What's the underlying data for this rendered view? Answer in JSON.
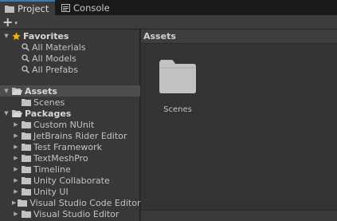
{
  "tabs": [
    {
      "label": "Project",
      "icon": "folder-icon",
      "active": true
    },
    {
      "label": "Console",
      "icon": "console-icon",
      "active": false
    }
  ],
  "toolbar": {
    "add_label": "+",
    "add_caret": "▾"
  },
  "tree": {
    "favorites": {
      "label": "Favorites",
      "items": [
        "All Materials",
        "All Models",
        "All Prefabs"
      ]
    },
    "assets": {
      "label": "Assets",
      "items": [
        "Scenes"
      ]
    },
    "packages": {
      "label": "Packages",
      "items": [
        "Custom NUnit",
        "JetBrains Rider Editor",
        "Test Framework",
        "TextMeshPro",
        "Timeline",
        "Unity Collaborate",
        "Unity UI",
        "Visual Studio Code Editor",
        "Visual Studio Editor"
      ]
    }
  },
  "content": {
    "breadcrumb": "Assets",
    "items": [
      {
        "label": "Scenes",
        "icon": "folder-icon"
      }
    ]
  },
  "colors": {
    "accent": "#3a79bb",
    "favorite_star": "#f1b300",
    "folder": "#c2c2c2"
  }
}
